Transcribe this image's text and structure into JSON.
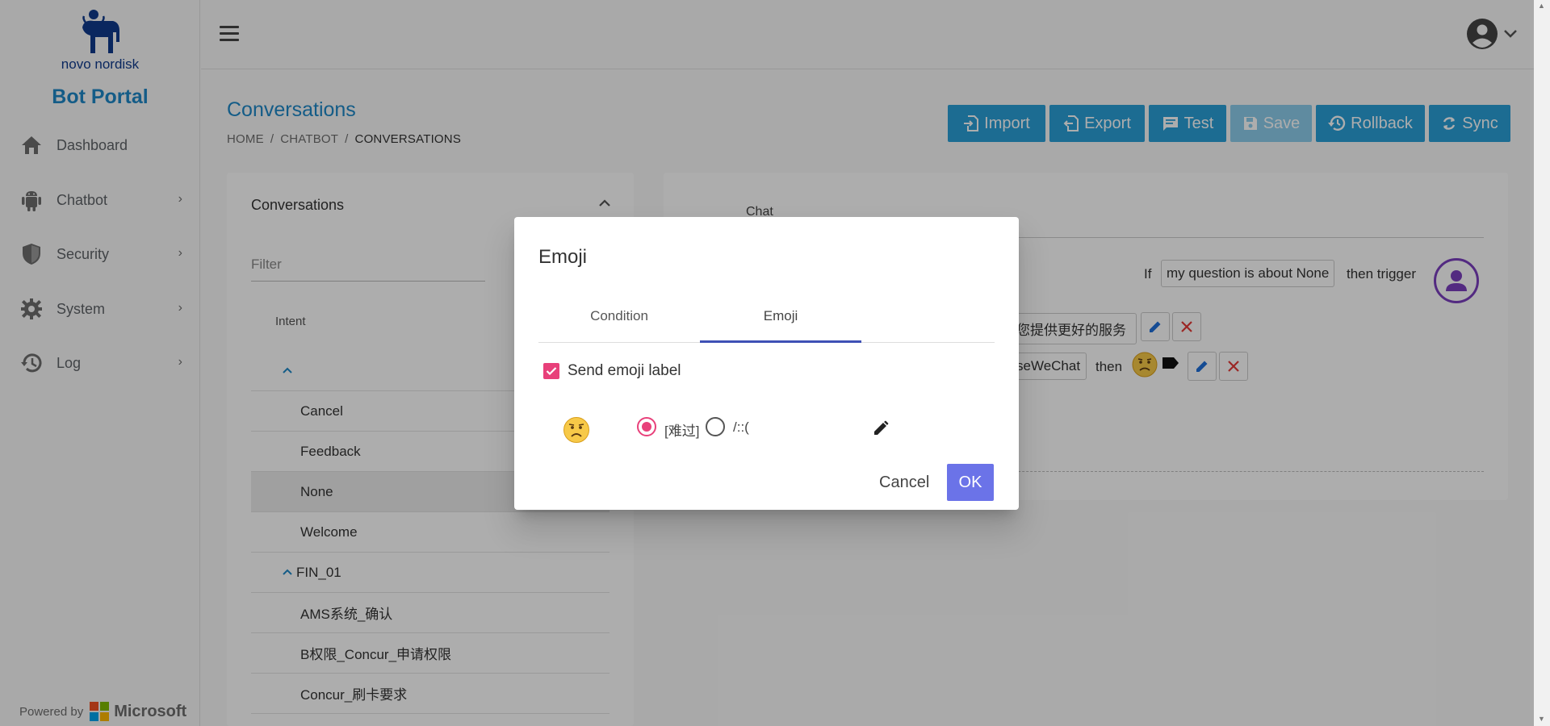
{
  "sidebar": {
    "logo_text": "novo nordisk",
    "brand": "Bot Portal",
    "items": [
      {
        "label": "Dashboard",
        "icon": "home-icon"
      },
      {
        "label": "Chatbot",
        "icon": "android-icon"
      },
      {
        "label": "Security",
        "icon": "shield-icon"
      },
      {
        "label": "System",
        "icon": "gear-icon"
      },
      {
        "label": "Log",
        "icon": "history-icon"
      }
    ],
    "powered_by": "Powered by",
    "microsoft": "Microsoft"
  },
  "header": {
    "title": "Conversations",
    "breadcrumb": [
      "HOME",
      "CHATBOT",
      "CONVERSATIONS"
    ],
    "separator": "/"
  },
  "toolbar": {
    "import": "Import",
    "export": "Export",
    "test": "Test",
    "save": "Save",
    "rollback": "Rollback",
    "sync": "Sync"
  },
  "left_panel": {
    "title": "Conversations",
    "filter_placeholder": "Filter",
    "column": "Intent",
    "rows": [
      "Cancel",
      "Feedback",
      "None",
      "Welcome"
    ],
    "group": "FIN_01",
    "group_rows": [
      "AMS系统_确认",
      "B权限_Concur_申请权限",
      "Concur_刷卡要求"
    ]
  },
  "right_panel": {
    "tab": "Chat",
    "if": "If",
    "condition": "my question is about None",
    "then_trigger": "then trigger",
    "response": "您提供更好的服务",
    "channel": "seWeChat",
    "then": "then"
  },
  "dialog": {
    "title": "Emoji",
    "tabs": [
      "Condition",
      "Emoji"
    ],
    "active_tab": "Emoji",
    "checkbox_label": "Send emoji label",
    "checkbox_checked": true,
    "option_1": "[难过]",
    "option_2": "/::(",
    "selected_option": "[难过]",
    "cancel": "Cancel",
    "ok": "OK"
  },
  "colors": {
    "accent": "#2a9fd8",
    "brand": "#1e88c8",
    "primary_button": "#6b73e8",
    "checkbox": "#e8407a",
    "tab_indicator": "#3f51b5"
  }
}
